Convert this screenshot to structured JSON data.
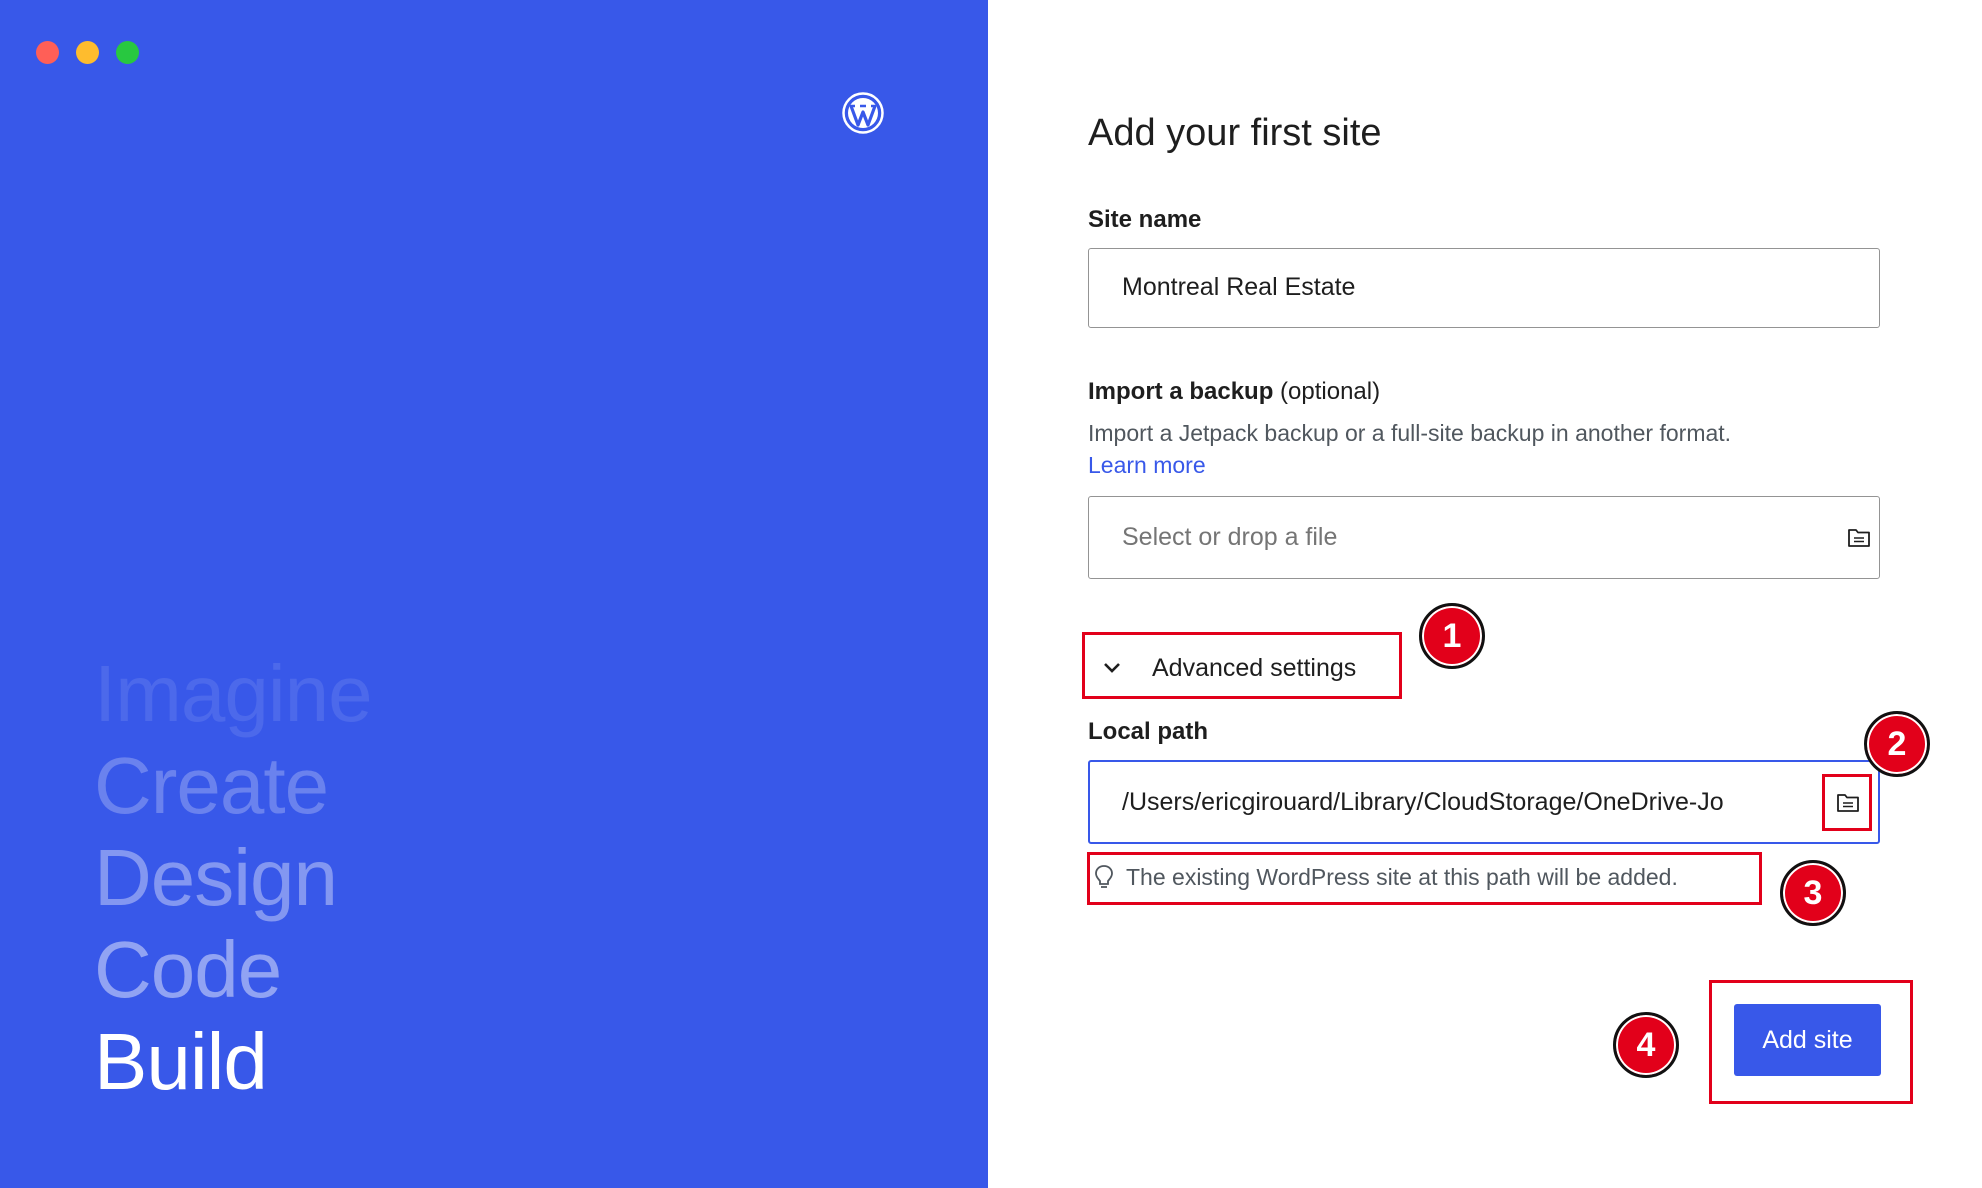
{
  "window": {
    "controls": [
      "close",
      "minimize",
      "zoom"
    ]
  },
  "hero": {
    "logo_icon": "wordpress-logo-icon",
    "words": [
      "Imagine",
      "Create",
      "Design",
      "Code",
      "Build"
    ]
  },
  "form": {
    "title": "Add your first site",
    "site_name": {
      "label": "Site name",
      "value": "Montreal Real Estate"
    },
    "import_backup": {
      "label": "Import a backup",
      "optional": "(optional)",
      "description": "Import a Jetpack backup or a full-site backup in another format.",
      "learn_more": "Learn more",
      "placeholder": "Select or drop a file",
      "icon": "folder-icon"
    },
    "advanced_settings": {
      "label": "Advanced settings",
      "icon": "chevron-down-icon"
    },
    "local_path": {
      "label": "Local path",
      "value": "/Users/ericgirouard/Library/CloudStorage/OneDrive-Jo",
      "icon": "folder-icon",
      "hint": "The existing WordPress site at this path will be added.",
      "hint_icon": "lightbulb-icon"
    },
    "submit": "Add site"
  },
  "annotations": {
    "badges": [
      "1",
      "2",
      "3",
      "4"
    ],
    "color": "#e2001a"
  },
  "colors": {
    "accent": "#3858e9",
    "text": "#1e1e1e",
    "muted": "#50575e"
  }
}
